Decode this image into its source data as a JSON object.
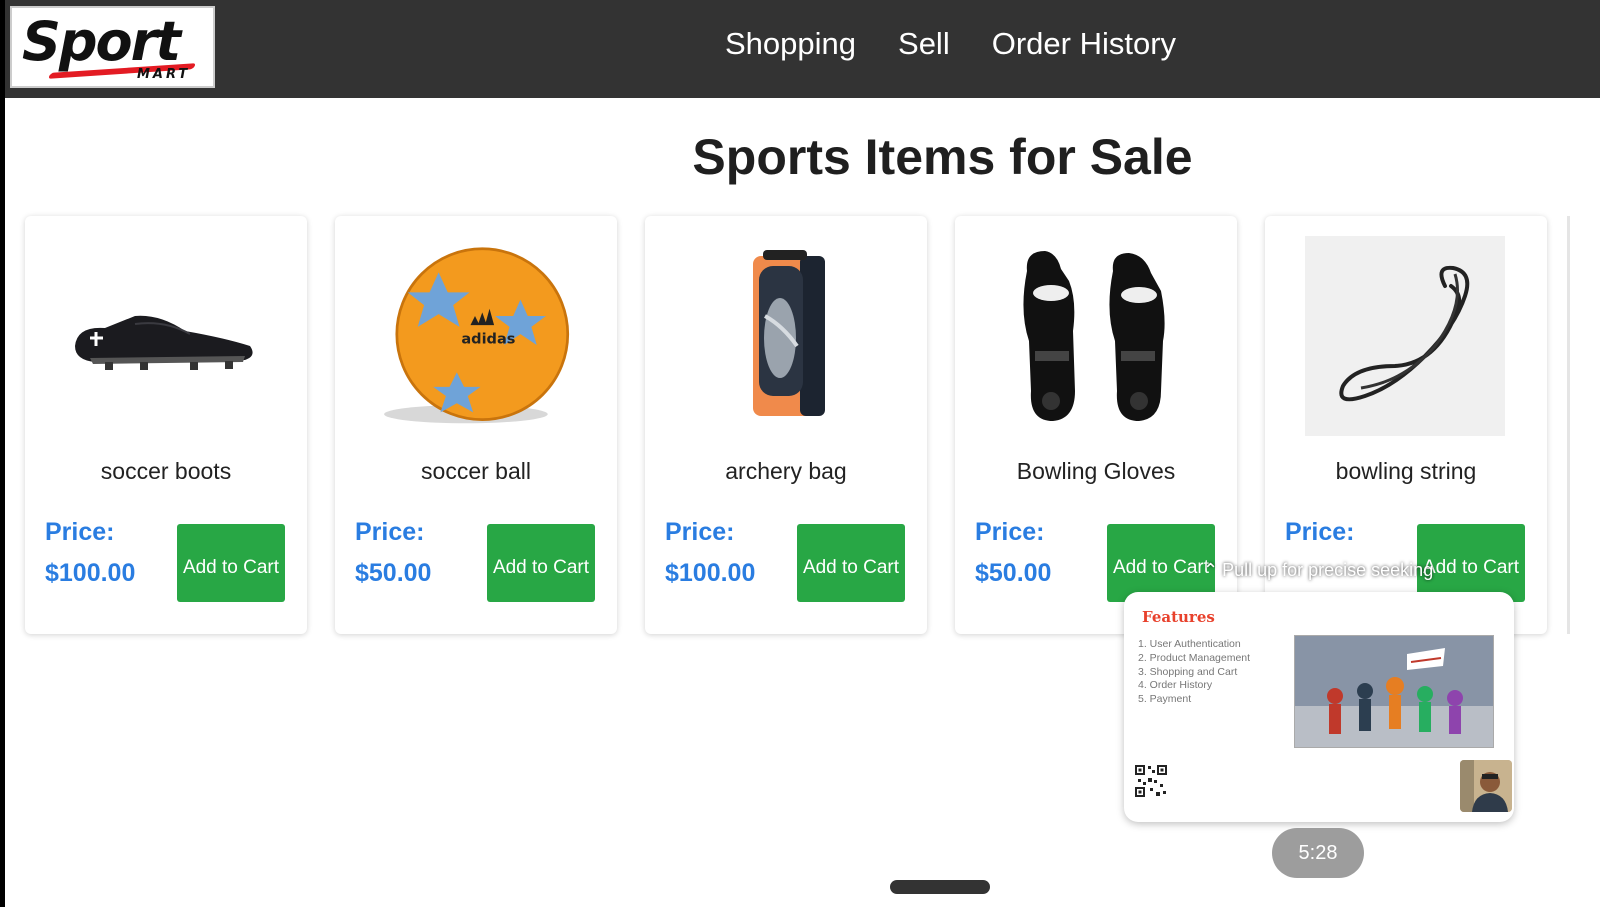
{
  "logo": {
    "main": "Sport",
    "sub": "MART"
  },
  "nav": {
    "items": [
      {
        "label": "Shopping"
      },
      {
        "label": "Sell"
      },
      {
        "label": "Order History"
      }
    ]
  },
  "main": {
    "title": "Sports Items for Sale",
    "products": [
      {
        "name": "soccer boots",
        "price_label": "Price:",
        "price": "$100.00",
        "button": "Add to Cart",
        "icon": "shoe-icon"
      },
      {
        "name": "soccer ball",
        "price_label": "Price:",
        "price": "$50.00",
        "button": "Add to Cart",
        "icon": "soccer-ball-icon"
      },
      {
        "name": "archery bag",
        "price_label": "Price:",
        "price": "$100.00",
        "button": "Add to Cart",
        "icon": "bag-icon"
      },
      {
        "name": "Bowling Gloves",
        "price_label": "Price:",
        "price": "$50.00",
        "button": "Add to Cart",
        "icon": "gloves-icon"
      },
      {
        "name": "bowling string",
        "price_label": "Price:",
        "price": "",
        "button": "Add to Cart",
        "icon": "string-icon"
      }
    ]
  },
  "overlay": {
    "seek_hint": "Pull up for precise seeking",
    "preview": {
      "title": "Features",
      "features": [
        "1.  User Authentication",
        "2.  Product Management",
        "3.  Shopping and Cart",
        "4.  Order History",
        "5.  Payment"
      ]
    },
    "timestamp": "5:28"
  },
  "colors": {
    "navbar": "#333333",
    "price": "#2a7de1",
    "button": "#28a745",
    "feature_title": "#e8412c"
  }
}
